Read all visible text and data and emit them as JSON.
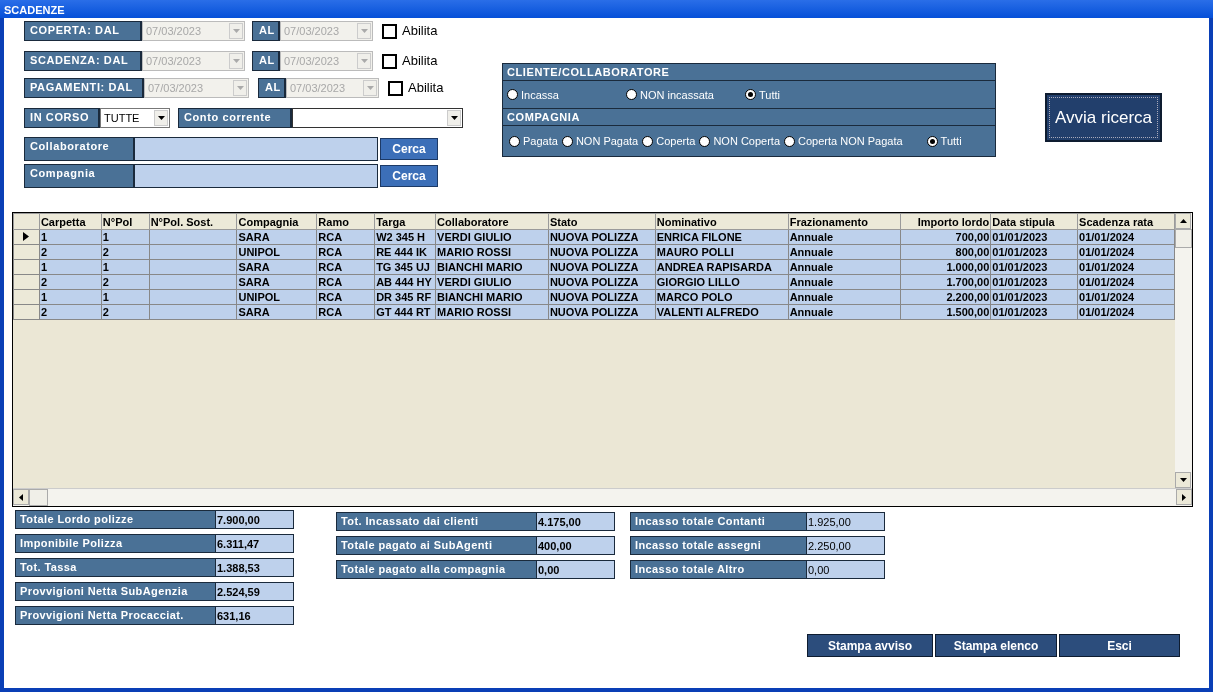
{
  "window": {
    "title": "SCADENZE"
  },
  "date_filters": [
    {
      "label": "COPERTA: DAL",
      "from": "07/03/2023",
      "to_label": "AL",
      "to": "07/03/2023",
      "disabled": true,
      "checkbox_label": "Abilita",
      "checked": false
    },
    {
      "label": "SCADENZA: DAL",
      "from": "07/03/2023",
      "to_label": "AL",
      "to": "07/03/2023",
      "disabled": true,
      "checkbox_label": "Abilita",
      "checked": false
    },
    {
      "label": "PAGAMENTI: DAL",
      "from": "07/03/2023",
      "to_label": "AL",
      "to": "07/03/2023",
      "disabled": true,
      "checkbox_label": "Abilita",
      "checked": false
    }
  ],
  "in_corso": {
    "label": "IN CORSO",
    "value": "TUTTE"
  },
  "conto_corrente": {
    "label": "Conto corrente"
  },
  "lookups": [
    {
      "label": "Collaboratore",
      "button": "Cerca"
    },
    {
      "label": "Compagnia",
      "button": "Cerca"
    }
  ],
  "filter_panels": [
    {
      "title": "CLIENTE/COLLABORATORE",
      "options": [
        {
          "label": "Incassa",
          "selected": false
        },
        {
          "label": "NON incassata",
          "selected": false
        },
        {
          "label": "Tutti",
          "selected": true
        }
      ]
    },
    {
      "title": "COMPAGNIA",
      "options": [
        {
          "label": "Pagata",
          "selected": false
        },
        {
          "label": "NON Pagata",
          "selected": false
        },
        {
          "label": "Coperta",
          "selected": false
        },
        {
          "label": "NON Coperta",
          "selected": false
        },
        {
          "label": "Coperta NON Pagata",
          "selected": false
        },
        {
          "label": "Tutti",
          "selected": true
        }
      ]
    }
  ],
  "search_button": "Avvia ricerca",
  "table": {
    "columns": [
      "Carpetta",
      "N°Pol",
      "N°Pol. Sost.",
      "Compagnia",
      "Ramo",
      "Targa",
      "Collaboratore",
      "Stato",
      "Nominativo",
      "Frazionamento",
      "Importo lordo",
      "Data stipula",
      "Scadenza rata"
    ],
    "rows": [
      {
        "current": true,
        "cells": [
          "1",
          "1",
          "",
          "SARA",
          "RCA",
          "W2 345 H",
          "VERDI GIULIO",
          "NUOVA POLIZZA",
          "ENRICA FILONE",
          "Annuale",
          "700,00",
          "01/01/2023",
          "01/01/2024"
        ]
      },
      {
        "current": false,
        "cells": [
          "2",
          "2",
          "",
          "UNIPOL",
          "RCA",
          "RE 444 IK",
          "MARIO ROSSI",
          "NUOVA POLIZZA",
          "MAURO POLLI",
          "Annuale",
          "800,00",
          "01/01/2023",
          "01/01/2024"
        ]
      },
      {
        "current": false,
        "cells": [
          "1",
          "1",
          "",
          "SARA",
          "RCA",
          "TG 345 UJ",
          "BIANCHI MARIO",
          "NUOVA POLIZZA",
          "ANDREA RAPISARDA",
          "Annuale",
          "1.000,00",
          "01/01/2023",
          "01/01/2024"
        ]
      },
      {
        "current": false,
        "cells": [
          "2",
          "2",
          "",
          "SARA",
          "RCA",
          "AB 444 HY",
          "VERDI GIULIO",
          "NUOVA POLIZZA",
          "GIORGIO LILLO",
          "Annuale",
          "1.700,00",
          "01/01/2023",
          "01/01/2024"
        ]
      },
      {
        "current": false,
        "cells": [
          "1",
          "1",
          "",
          "UNIPOL",
          "RCA",
          "DR 345 RF",
          "BIANCHI MARIO",
          "NUOVA POLIZZA",
          "MARCO POLO",
          "Annuale",
          "2.200,00",
          "01/01/2023",
          "01/01/2024"
        ]
      },
      {
        "current": false,
        "cells": [
          "2",
          "2",
          "",
          "SARA",
          "RCA",
          "GT 444 RT",
          "MARIO ROSSI",
          "NUOVA POLIZZA",
          "VALENTI ALFREDO",
          "Annuale",
          "1.500,00",
          "01/01/2023",
          "01/01/2024"
        ]
      }
    ]
  },
  "totals": [
    [
      {
        "label": "Totale Lordo polizze",
        "value": "7.900,00"
      },
      {
        "label": "Imponibile Polizza",
        "value": "6.311,47"
      },
      {
        "label": "Tot. Tassa",
        "value": "1.388,53"
      },
      {
        "label": "Provvigioni Netta SubAgenzia",
        "value": "2.524,59"
      },
      {
        "label": "Provvigioni Netta Procacciat.",
        "value": "631,16"
      }
    ],
    [
      {
        "label": "Tot. Incassato dai clienti",
        "value": "4.175,00"
      },
      {
        "label": "Totale pagato ai SubAgenti",
        "value": "400,00"
      },
      {
        "label": "Totale pagato alla compagnia",
        "value": "0,00"
      }
    ],
    [
      {
        "label": "Incasso totale Contanti",
        "value": "1.925,00"
      },
      {
        "label": "Incasso totale assegni",
        "value": "2.250,00"
      },
      {
        "label": "Incasso totale Altro",
        "value": "0,00"
      }
    ]
  ],
  "buttons": [
    "Stampa avviso",
    "Stampa elenco",
    "Esci"
  ]
}
